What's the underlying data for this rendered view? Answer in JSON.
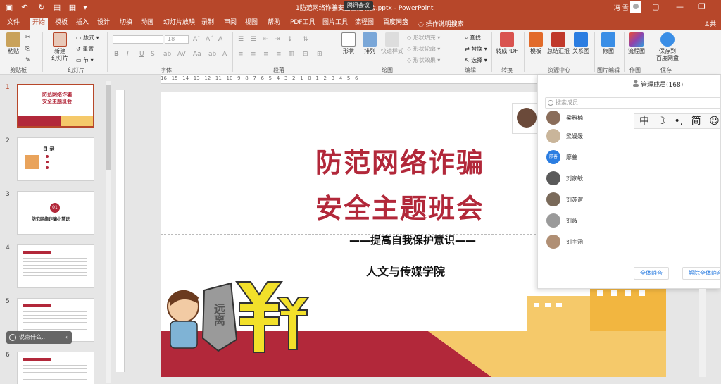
{
  "titlebar": {
    "doc_title": "1防范网络诈骗安全主题班会.pptx",
    "app_name": "PowerPoint",
    "meeting_badge": "腾讯会议",
    "user_name": "冯 雪"
  },
  "tabs": [
    "文件",
    "开始",
    "模板",
    "插入",
    "设计",
    "切换",
    "动画",
    "幻灯片放映",
    "录制",
    "审阅",
    "视图",
    "帮助",
    "PDF工具",
    "图片工具",
    "流程图",
    "百度网盘"
  ],
  "active_tab": "开始",
  "tell_me": "操作说明搜索",
  "share": "共享",
  "ribbon": {
    "paste": "粘贴",
    "new_slide": "新建\n幻灯片",
    "layout": "版式",
    "reset": "重置",
    "section": "节",
    "font_size": "18",
    "shape": "形状",
    "arrange": "排列",
    "quick_style": "快速样式",
    "shape_fill": "形状填充",
    "shape_outline": "形状轮廓",
    "shape_effect": "形状效果",
    "find": "查找",
    "replace": "替换",
    "select": "选择",
    "to_pdf": "转成PDF",
    "template": "模板",
    "summary": "总结汇报",
    "relation": "关系图",
    "retouch": "修图",
    "flowchart": "流程图",
    "save_baidu": "保存到\n百度网盘",
    "groups": [
      "剪贴板",
      "幻灯片",
      "字体",
      "段落",
      "绘图",
      "编辑",
      "转换",
      "资源中心",
      "图片编辑",
      "作图",
      "保存"
    ]
  },
  "slides_panel": {
    "numbers": [
      "1",
      "2",
      "3",
      "4",
      "5",
      "6"
    ],
    "thumb1_title": "防范网络诈骗",
    "thumb1_title2": "安全主题班会",
    "thumb2_title": "目 录",
    "thumb3_num": "01",
    "thumb3_title": "防范网络诈骗小常识",
    "speaking": "说点什么..."
  },
  "ruler_text": "16 · 15 · 14 · 13 · 12 · 11 · 10 · 9 · 8 · 7 · 6 · 5 · 4 · 3 · 2 · 1 · 0 · 1 · 2 · 3 · 4 · 5 · 6",
  "slide": {
    "title_line1": "防范网络诈骗",
    "title_line2": "安全主题班会",
    "subtitle": "——提高自我保护意识——",
    "school": "人文与传媒学院",
    "sign_text": "远离",
    "colors": {
      "red": "#b2283a",
      "yellow": "#f5c96a"
    }
  },
  "members_panel": {
    "title": "管理成员(168)",
    "search_placeholder": "搜索成员",
    "members": [
      {
        "name": "梁雅楠",
        "avatar": ""
      },
      {
        "name": "梁媛媛",
        "avatar": ""
      },
      {
        "name": "廖善",
        "avatar": "廖善"
      },
      {
        "name": "刘家敏",
        "avatar": ""
      },
      {
        "name": "刘苏谊",
        "avatar": ""
      },
      {
        "name": "刘薇",
        "avatar": ""
      },
      {
        "name": "刘宇涵",
        "avatar": ""
      }
    ],
    "mute_all": "全体静音",
    "unmute_all": "解除全体静音"
  },
  "ime": [
    "中",
    "☽",
    "•,",
    "简",
    "☺"
  ]
}
